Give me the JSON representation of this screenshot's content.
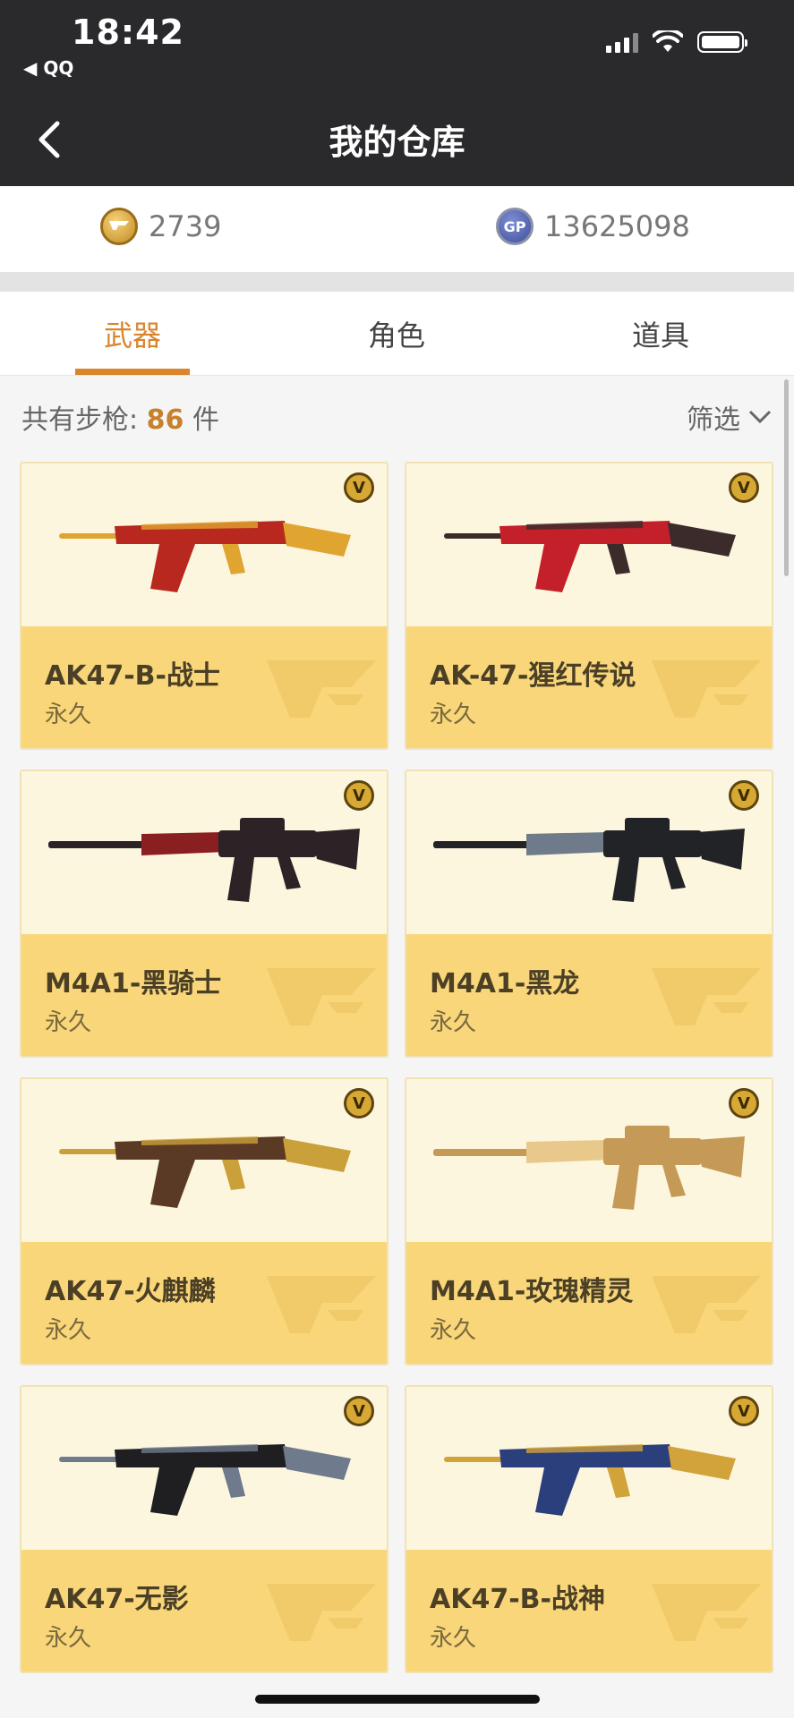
{
  "status": {
    "time": "18:42",
    "back_app": "◀ QQ"
  },
  "header": {
    "title": "我的仓库"
  },
  "currency": {
    "cf_value": "2739",
    "gp_value": "13625098",
    "cf_icon": "cf-coin-icon",
    "gp_icon": "gp-coin-icon",
    "gp_label": "GP"
  },
  "tabs": [
    {
      "label": "武器"
    },
    {
      "label": "角色"
    },
    {
      "label": "道具"
    }
  ],
  "listing": {
    "count_prefix": "共有步枪: ",
    "count": "86",
    "count_suffix": " 件",
    "filter_label": "筛选"
  },
  "badge_label": "V",
  "items": [
    {
      "name": "AK47-B-战士",
      "duration": "永久",
      "colors": [
        "#b8281e",
        "#e0a431"
      ]
    },
    {
      "name": "AK-47-猩红传说",
      "duration": "永久",
      "colors": [
        "#c3202a",
        "#3b2b2b"
      ]
    },
    {
      "name": "M4A1-黑骑士",
      "duration": "永久",
      "colors": [
        "#2c2326",
        "#8a1f22"
      ]
    },
    {
      "name": "M4A1-黑龙",
      "duration": "永久",
      "colors": [
        "#222326",
        "#6f7b8a"
      ]
    },
    {
      "name": "AK47-火麒麟",
      "duration": "永久",
      "colors": [
        "#5a3a24",
        "#c9a03a"
      ]
    },
    {
      "name": "M4A1-玫瑰精灵",
      "duration": "永久",
      "colors": [
        "#c49a56",
        "#e8c98b"
      ]
    },
    {
      "name": "AK47-无影",
      "duration": "永久",
      "colors": [
        "#1f1f22",
        "#6f7a8c"
      ]
    },
    {
      "name": "AK47-B-战神",
      "duration": "永久",
      "colors": [
        "#2b3f7c",
        "#d2a33a"
      ]
    }
  ],
  "accent": "#d9852c"
}
